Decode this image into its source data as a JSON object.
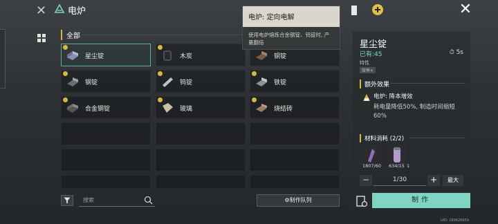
{
  "header": {
    "title": "电炉",
    "logo_glyph": "✕",
    "close_glyph": "✕"
  },
  "category": {
    "label": "全部"
  },
  "items": [
    {
      "label": "星尘锭",
      "icon": "ingot-gem",
      "selected": true
    },
    {
      "label": "木炭",
      "icon": "charcoal"
    },
    {
      "label": "铜锭",
      "icon": "copper-ingot"
    },
    {
      "label": "钢锭",
      "icon": "steel-ingot"
    },
    {
      "label": "钨锭",
      "icon": "tungsten-ingot"
    },
    {
      "label": "铁锭",
      "icon": "iron-ingot"
    },
    {
      "label": "合金钢锭",
      "icon": "alloy-ingot"
    },
    {
      "label": "玻璃",
      "icon": "glass"
    },
    {
      "label": "烧结砖",
      "icon": "brick"
    }
  ],
  "search": {
    "placeholder": "搜索"
  },
  "queue_button": {
    "label": "⚙制作队列"
  },
  "tooltip": {
    "title": "电炉: 定向电解",
    "body": "使用电炉熔炼合金钢锭、钨锭时, 产量翻倍"
  },
  "detail": {
    "name": "星尘锭",
    "owned": "已有:45",
    "time": "5s",
    "traits_label": "特性",
    "trait_tag": "效率+",
    "extra_label": "额外效果",
    "effect_name": "电炉: 降本增效",
    "effect_desc": "耗电量降低50%, 制造时间缩短60%",
    "materials_label": "材料消耗 (2/2)",
    "materials": [
      {
        "count": "1807/60",
        "icon": "crystal-shard"
      },
      {
        "count": "634/15",
        "icon": "vial",
        "extra": "1"
      }
    ],
    "quantity": "1/30",
    "max_label": "最大",
    "craft_label": "制作"
  },
  "uid": "UID: 160626659",
  "colors": {
    "accent": "#7ed5c3",
    "gold": "#d8b73d",
    "selected_border": "#62ad9d"
  }
}
